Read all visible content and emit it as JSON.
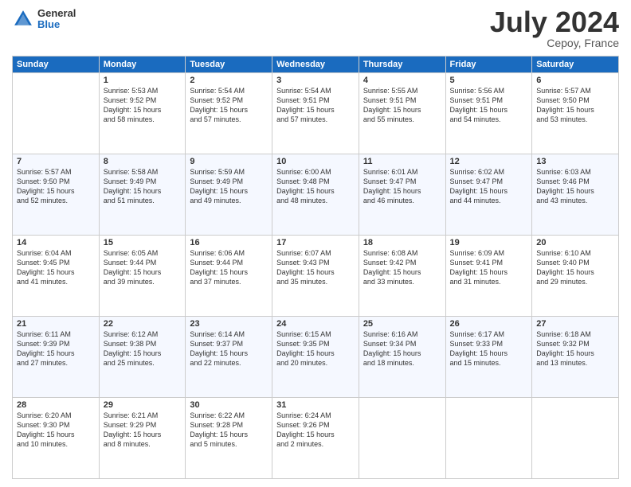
{
  "header": {
    "logo": {
      "general": "General",
      "blue": "Blue"
    },
    "title": "July 2024",
    "location": "Cepoy, France"
  },
  "columns": [
    "Sunday",
    "Monday",
    "Tuesday",
    "Wednesday",
    "Thursday",
    "Friday",
    "Saturday"
  ],
  "weeks": [
    [
      {
        "day": "",
        "info": ""
      },
      {
        "day": "1",
        "info": "Sunrise: 5:53 AM\nSunset: 9:52 PM\nDaylight: 15 hours\nand 58 minutes."
      },
      {
        "day": "2",
        "info": "Sunrise: 5:54 AM\nSunset: 9:52 PM\nDaylight: 15 hours\nand 57 minutes."
      },
      {
        "day": "3",
        "info": "Sunrise: 5:54 AM\nSunset: 9:51 PM\nDaylight: 15 hours\nand 57 minutes."
      },
      {
        "day": "4",
        "info": "Sunrise: 5:55 AM\nSunset: 9:51 PM\nDaylight: 15 hours\nand 55 minutes."
      },
      {
        "day": "5",
        "info": "Sunrise: 5:56 AM\nSunset: 9:51 PM\nDaylight: 15 hours\nand 54 minutes."
      },
      {
        "day": "6",
        "info": "Sunrise: 5:57 AM\nSunset: 9:50 PM\nDaylight: 15 hours\nand 53 minutes."
      }
    ],
    [
      {
        "day": "7",
        "info": "Sunrise: 5:57 AM\nSunset: 9:50 PM\nDaylight: 15 hours\nand 52 minutes."
      },
      {
        "day": "8",
        "info": "Sunrise: 5:58 AM\nSunset: 9:49 PM\nDaylight: 15 hours\nand 51 minutes."
      },
      {
        "day": "9",
        "info": "Sunrise: 5:59 AM\nSunset: 9:49 PM\nDaylight: 15 hours\nand 49 minutes."
      },
      {
        "day": "10",
        "info": "Sunrise: 6:00 AM\nSunset: 9:48 PM\nDaylight: 15 hours\nand 48 minutes."
      },
      {
        "day": "11",
        "info": "Sunrise: 6:01 AM\nSunset: 9:47 PM\nDaylight: 15 hours\nand 46 minutes."
      },
      {
        "day": "12",
        "info": "Sunrise: 6:02 AM\nSunset: 9:47 PM\nDaylight: 15 hours\nand 44 minutes."
      },
      {
        "day": "13",
        "info": "Sunrise: 6:03 AM\nSunset: 9:46 PM\nDaylight: 15 hours\nand 43 minutes."
      }
    ],
    [
      {
        "day": "14",
        "info": "Sunrise: 6:04 AM\nSunset: 9:45 PM\nDaylight: 15 hours\nand 41 minutes."
      },
      {
        "day": "15",
        "info": "Sunrise: 6:05 AM\nSunset: 9:44 PM\nDaylight: 15 hours\nand 39 minutes."
      },
      {
        "day": "16",
        "info": "Sunrise: 6:06 AM\nSunset: 9:44 PM\nDaylight: 15 hours\nand 37 minutes."
      },
      {
        "day": "17",
        "info": "Sunrise: 6:07 AM\nSunset: 9:43 PM\nDaylight: 15 hours\nand 35 minutes."
      },
      {
        "day": "18",
        "info": "Sunrise: 6:08 AM\nSunset: 9:42 PM\nDaylight: 15 hours\nand 33 minutes."
      },
      {
        "day": "19",
        "info": "Sunrise: 6:09 AM\nSunset: 9:41 PM\nDaylight: 15 hours\nand 31 minutes."
      },
      {
        "day": "20",
        "info": "Sunrise: 6:10 AM\nSunset: 9:40 PM\nDaylight: 15 hours\nand 29 minutes."
      }
    ],
    [
      {
        "day": "21",
        "info": "Sunrise: 6:11 AM\nSunset: 9:39 PM\nDaylight: 15 hours\nand 27 minutes."
      },
      {
        "day": "22",
        "info": "Sunrise: 6:12 AM\nSunset: 9:38 PM\nDaylight: 15 hours\nand 25 minutes."
      },
      {
        "day": "23",
        "info": "Sunrise: 6:14 AM\nSunset: 9:37 PM\nDaylight: 15 hours\nand 22 minutes."
      },
      {
        "day": "24",
        "info": "Sunrise: 6:15 AM\nSunset: 9:35 PM\nDaylight: 15 hours\nand 20 minutes."
      },
      {
        "day": "25",
        "info": "Sunrise: 6:16 AM\nSunset: 9:34 PM\nDaylight: 15 hours\nand 18 minutes."
      },
      {
        "day": "26",
        "info": "Sunrise: 6:17 AM\nSunset: 9:33 PM\nDaylight: 15 hours\nand 15 minutes."
      },
      {
        "day": "27",
        "info": "Sunrise: 6:18 AM\nSunset: 9:32 PM\nDaylight: 15 hours\nand 13 minutes."
      }
    ],
    [
      {
        "day": "28",
        "info": "Sunrise: 6:20 AM\nSunset: 9:30 PM\nDaylight: 15 hours\nand 10 minutes."
      },
      {
        "day": "29",
        "info": "Sunrise: 6:21 AM\nSunset: 9:29 PM\nDaylight: 15 hours\nand 8 minutes."
      },
      {
        "day": "30",
        "info": "Sunrise: 6:22 AM\nSunset: 9:28 PM\nDaylight: 15 hours\nand 5 minutes."
      },
      {
        "day": "31",
        "info": "Sunrise: 6:24 AM\nSunset: 9:26 PM\nDaylight: 15 hours\nand 2 minutes."
      },
      {
        "day": "",
        "info": ""
      },
      {
        "day": "",
        "info": ""
      },
      {
        "day": "",
        "info": ""
      }
    ]
  ]
}
